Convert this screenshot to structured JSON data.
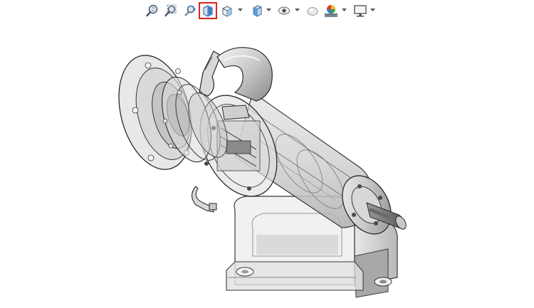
{
  "toolbar": {
    "tools": [
      {
        "name": "zoom-to-fit",
        "icon": "magnifier-fit-icon"
      },
      {
        "name": "zoom-to-area",
        "icon": "magnifier-area-icon"
      },
      {
        "name": "previous-view",
        "icon": "previous-view-icon"
      },
      {
        "name": "section-view",
        "icon": "section-view-icon",
        "active": true
      },
      {
        "name": "dynamic-annotation-views",
        "icon": "dynamic-annotation-icon",
        "has_menu": true
      },
      {
        "name": "view-orientation",
        "icon": "view-orientation-icon",
        "has_menu": true
      },
      {
        "name": "display-style",
        "icon": "display-style-icon",
        "has_menu": true
      },
      {
        "name": "hide-show-items",
        "icon": "eye-icon",
        "has_menu": true
      },
      {
        "name": "edit-appearance",
        "icon": "appearance-icon"
      },
      {
        "name": "apply-scene",
        "icon": "scene-icon",
        "has_menu": true
      },
      {
        "name": "view-settings",
        "icon": "monitor-icon",
        "has_menu": true
      }
    ],
    "active_highlight_color": "#e2231a"
  },
  "viewport": {
    "model": "motor-pump-assembly",
    "display_mode": "transparent-section",
    "background_color": "#ffffff"
  }
}
